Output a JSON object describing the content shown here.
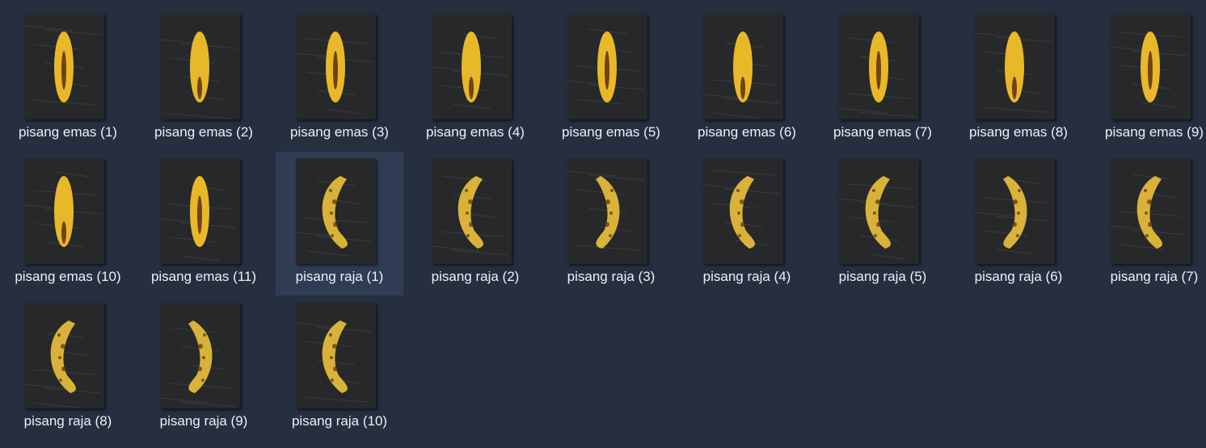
{
  "files": [
    {
      "name": "pisang emas (1)",
      "icon": "banana-emas-thumbnail",
      "selected": false
    },
    {
      "name": "pisang emas (2)",
      "icon": "banana-emas-thumbnail",
      "selected": false
    },
    {
      "name": "pisang emas (3)",
      "icon": "banana-emas-thumbnail",
      "selected": false
    },
    {
      "name": "pisang emas (4)",
      "icon": "banana-emas-thumbnail",
      "selected": false
    },
    {
      "name": "pisang emas (5)",
      "icon": "banana-emas-thumbnail",
      "selected": false
    },
    {
      "name": "pisang emas (6)",
      "icon": "banana-emas-thumbnail",
      "selected": false
    },
    {
      "name": "pisang emas (7)",
      "icon": "banana-emas-thumbnail",
      "selected": false
    },
    {
      "name": "pisang emas (8)",
      "icon": "banana-emas-thumbnail",
      "selected": false
    },
    {
      "name": "pisang emas (9)",
      "icon": "banana-emas-thumbnail",
      "selected": false
    },
    {
      "name": "pisang emas (10)",
      "icon": "banana-emas-thumbnail",
      "selected": false
    },
    {
      "name": "pisang emas (11)",
      "icon": "banana-emas-thumbnail",
      "selected": false
    },
    {
      "name": "pisang raja (1)",
      "icon": "banana-raja-thumbnail",
      "selected": true
    },
    {
      "name": "pisang raja (2)",
      "icon": "banana-raja-thumbnail",
      "selected": false
    },
    {
      "name": "pisang raja (3)",
      "icon": "banana-raja-thumbnail",
      "selected": false
    },
    {
      "name": "pisang raja (4)",
      "icon": "banana-raja-thumbnail",
      "selected": false
    },
    {
      "name": "pisang raja (5)",
      "icon": "banana-raja-thumbnail",
      "selected": false
    },
    {
      "name": "pisang raja (6)",
      "icon": "banana-raja-thumbnail",
      "selected": false
    },
    {
      "name": "pisang raja (7)",
      "icon": "banana-raja-thumbnail",
      "selected": false
    },
    {
      "name": "pisang raja (8)",
      "icon": "banana-raja-thumbnail",
      "selected": false
    },
    {
      "name": "pisang raja (9)",
      "icon": "banana-raja-thumbnail",
      "selected": false
    },
    {
      "name": "pisang raja (10)",
      "icon": "banana-raja-thumbnail",
      "selected": false
    }
  ],
  "colors": {
    "background": "#252f3f",
    "selection": "#2f3c53",
    "label_text": "#eef1f6",
    "photo_backdrop": "#26282a",
    "banana_emas": "#e8b829",
    "banana_raja": "#d9b23a",
    "banana_spot": "#5a2d12"
  }
}
